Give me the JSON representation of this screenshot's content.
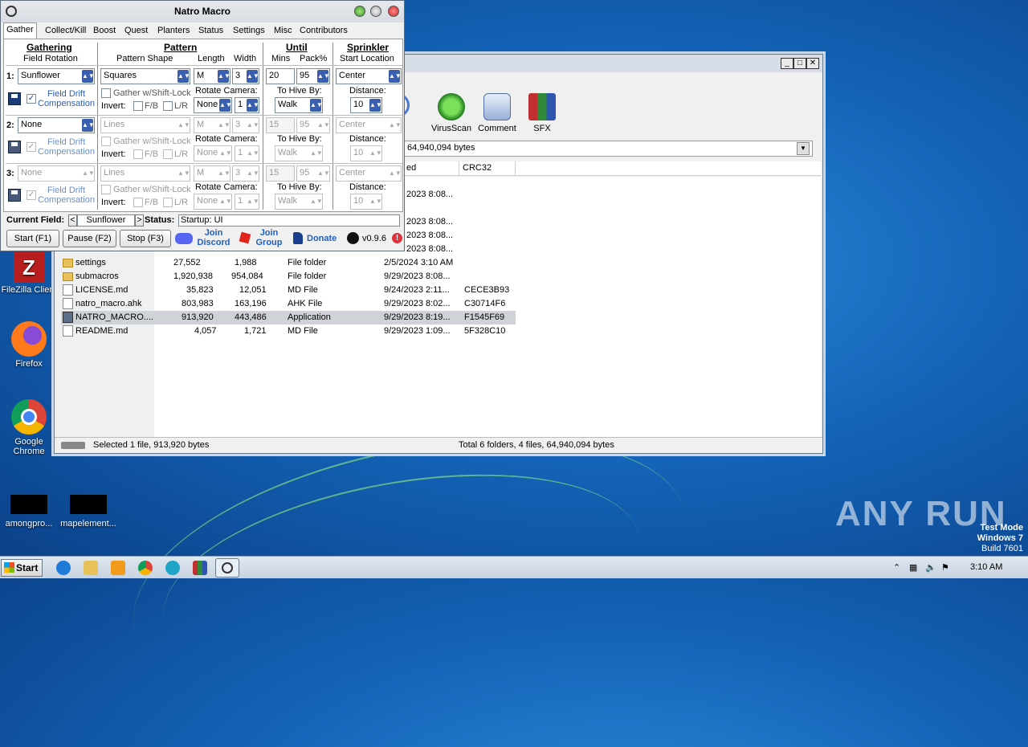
{
  "natro": {
    "title": "Natro Macro",
    "tabs": [
      "Gather",
      "Collect/Kill",
      "Boost",
      "Quest",
      "Planters",
      "Status",
      "Settings",
      "Misc",
      "Contributors"
    ],
    "headers": {
      "gathering": "Gathering",
      "field_rotation": "Field Rotation",
      "pattern": "Pattern",
      "pattern_shape": "Pattern Shape",
      "length": "Length",
      "width": "Width",
      "until": "Until",
      "mins": "Mins",
      "pack": "Pack%",
      "sprinkler": "Sprinkler",
      "start_location": "Start Location"
    },
    "labels": {
      "gather_shift_lock": "Gather w/Shift-Lock",
      "invert": "Invert:",
      "fb": "F/B",
      "lr": "L/R",
      "rotate_camera": "Rotate Camera:",
      "to_hive_by": "To Hive By:",
      "distance": "Distance:",
      "field_drift_1": "Field Drift",
      "field_drift_2": "Compensation"
    },
    "rows": [
      {
        "num": "1:",
        "field": "Sunflower",
        "shape": "Squares",
        "length": "M",
        "width": "3",
        "mins": "20",
        "pack": "95",
        "sprinkler": "Center",
        "rotate": "None",
        "rotate_n": "1",
        "hive": "Walk",
        "distance": "10"
      },
      {
        "num": "2:",
        "field": "None",
        "shape": "Lines",
        "length": "M",
        "width": "3",
        "mins": "15",
        "pack": "95",
        "sprinkler": "Center",
        "rotate": "None",
        "rotate_n": "1",
        "hive": "Walk",
        "distance": "10"
      },
      {
        "num": "3:",
        "field": "None",
        "shape": "Lines",
        "length": "M",
        "width": "3",
        "mins": "15",
        "pack": "95",
        "sprinkler": "Center",
        "rotate": "None",
        "rotate_n": "1",
        "hive": "Walk",
        "distance": "10"
      }
    ],
    "current_field_label": "Current Field:",
    "current_field": "Sunflower",
    "prev": "<",
    "next": ">",
    "status_label": "Status:",
    "status_value": "Startup: UI",
    "buttons": {
      "start": "Start (F1)",
      "pause": "Pause (F2)",
      "stop": "Stop (F3)"
    },
    "links": {
      "discord_1": "Join",
      "discord_2": "Discord",
      "group_1": "Join",
      "group_2": "Group",
      "donate": "Donate",
      "version": "v0.9.6",
      "alert": "!"
    }
  },
  "winrar": {
    "tools": [
      "VirusScan",
      "Comment",
      "SFX"
    ],
    "path_text": "64,940,094 bytes",
    "columns": [
      "ed",
      "CRC32"
    ],
    "partial_rows": [
      "2023 8:08...",
      "2023 8:08...",
      "2023 8:08...",
      "2023 8:08..."
    ],
    "rows": [
      {
        "name": "settings",
        "size": "27,552",
        "packed": "1,988",
        "type": "File folder",
        "modified": "2/5/2024 3:10 AM",
        "crc": "",
        "icon": "folder"
      },
      {
        "name": "submacros",
        "size": "1,920,938",
        "packed": "954,084",
        "type": "File folder",
        "modified": "9/29/2023 8:08...",
        "crc": "",
        "icon": "folder"
      },
      {
        "name": "LICENSE.md",
        "size": "35,823",
        "packed": "12,051",
        "type": "MD File",
        "modified": "9/24/2023 2:11...",
        "crc": "CECE3B93",
        "icon": "file"
      },
      {
        "name": "natro_macro.ahk",
        "size": "803,983",
        "packed": "163,196",
        "type": "AHK File",
        "modified": "9/29/2023 8:02...",
        "crc": "C30714F6",
        "icon": "file"
      },
      {
        "name": "NATRO_MACRO....",
        "size": "913,920",
        "packed": "443,486",
        "type": "Application",
        "modified": "9/29/2023 8:19...",
        "crc": "F1545F69",
        "icon": "app"
      },
      {
        "name": "README.md",
        "size": "4,057",
        "packed": "1,721",
        "type": "MD File",
        "modified": "9/29/2023 1:09...",
        "crc": "5F328C10",
        "icon": "file"
      }
    ],
    "status_left": "Selected 1 file, 913,920 bytes",
    "status_right": "Total 6 folders, 4 files, 64,940,094 bytes"
  },
  "desktop": {
    "icons": [
      "FileZilla Client",
      "Firefox",
      "Google Chrome",
      "amongpro...",
      "mapelement..."
    ]
  },
  "taskbar": {
    "start": "Start",
    "time": "3:10 AM"
  },
  "watermark": {
    "line1": "Test Mode",
    "line2": "Windows 7",
    "line3": "Build 7601",
    "brand": "ANY RUN"
  }
}
